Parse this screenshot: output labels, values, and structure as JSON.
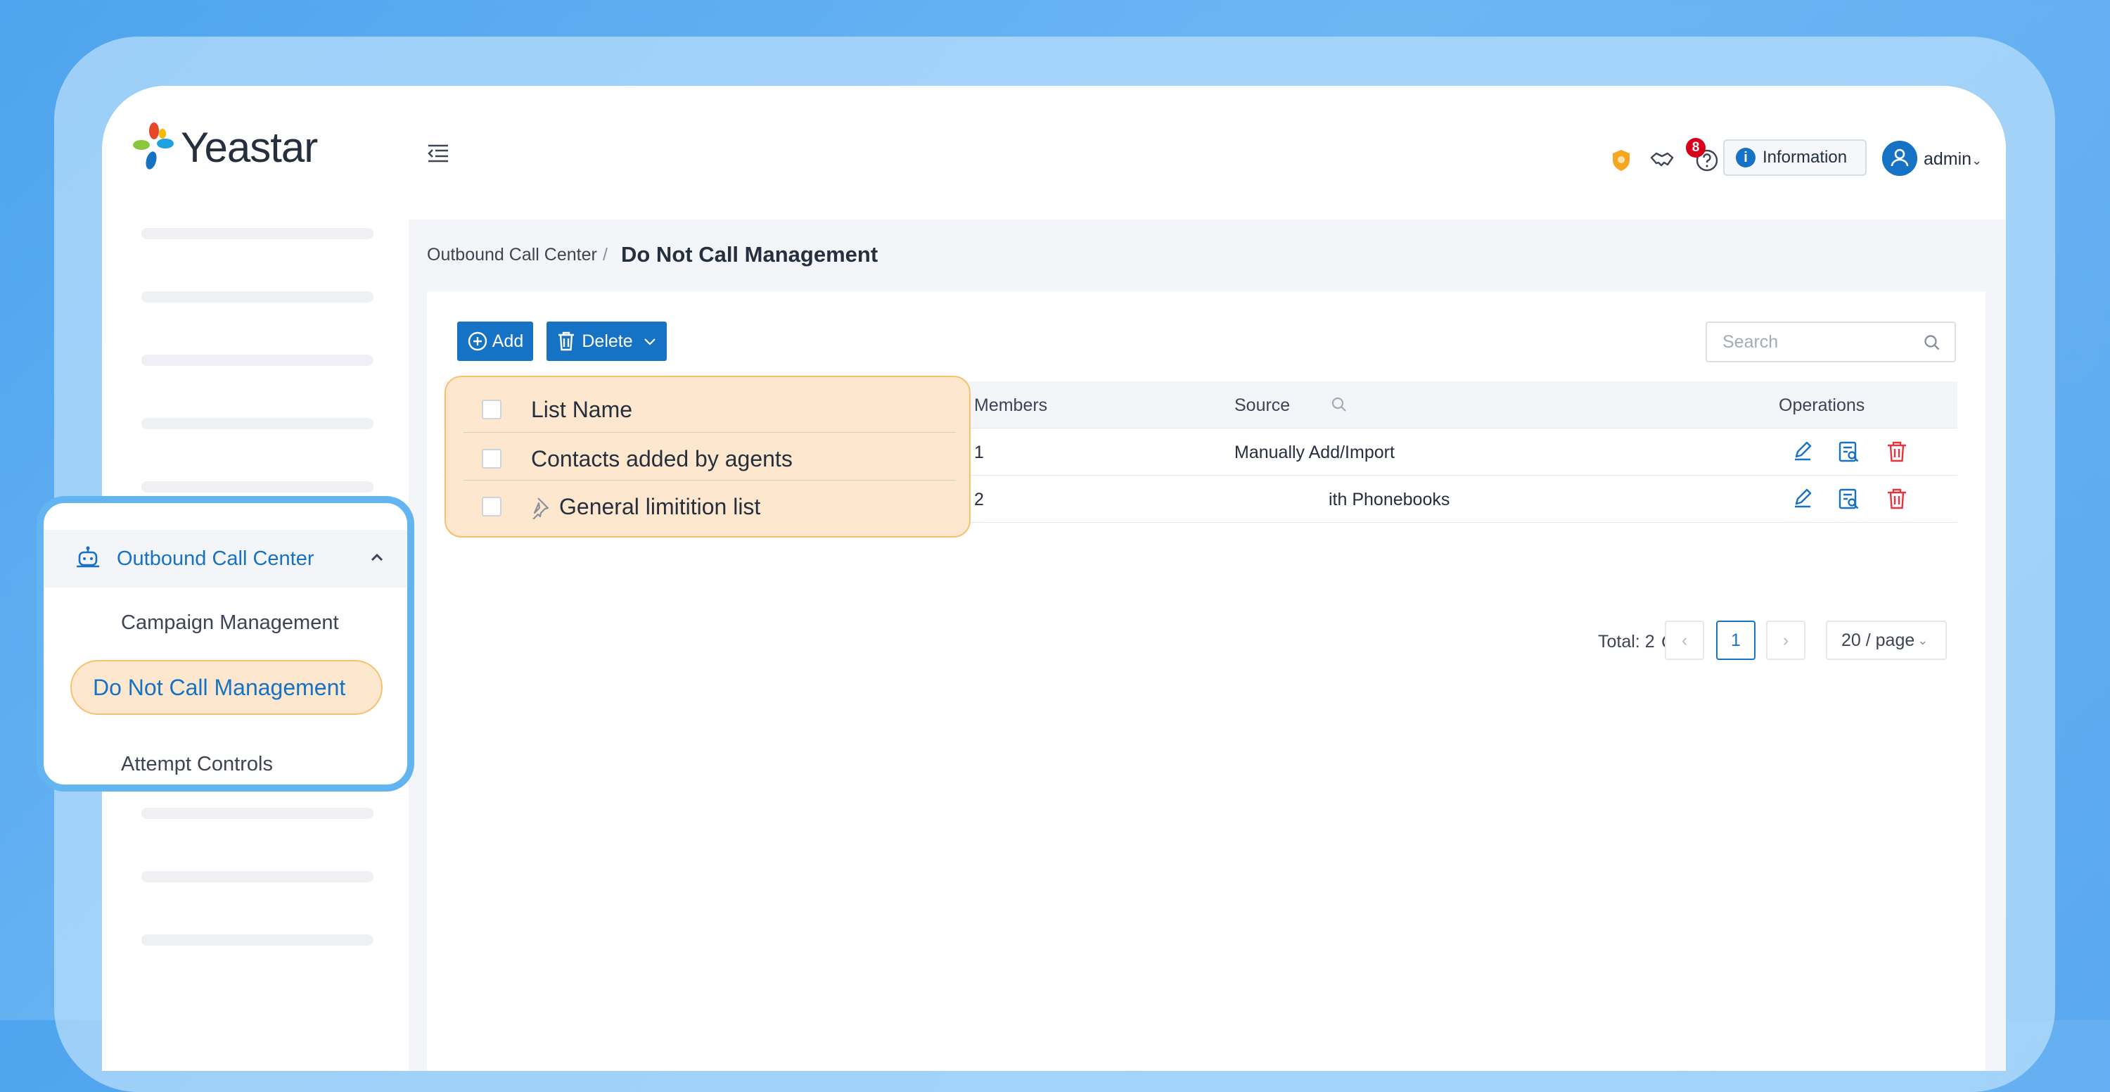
{
  "app": {
    "brand": "Yeastar"
  },
  "header": {
    "notification_count": "8",
    "information_label": "Information",
    "user_label": "admin"
  },
  "breadcrumb": {
    "parent": "Outbound Call Center",
    "separator": "/",
    "current": "Do Not Call Management"
  },
  "toolbar": {
    "add_label": "Add",
    "delete_label": "Delete",
    "search_placeholder": "Search"
  },
  "table": {
    "columns": [
      "List Name",
      "Members",
      "Source",
      "Operations"
    ],
    "rows": [
      {
        "name": "Contacts added by agents",
        "members": "1",
        "source": "Manually Add/Import",
        "pinned": false
      },
      {
        "name": "General limitition list",
        "members": "2",
        "source": "ith Phonebooks",
        "pinned": true
      }
    ]
  },
  "pagination": {
    "total_label": "Total: 2",
    "current_page": "1",
    "page_size": "20 / page"
  },
  "sidebar": {
    "group_label": "Outbound Call Center",
    "items": [
      "Campaign Management",
      "Do Not Call Management",
      "Attempt Controls"
    ],
    "active_item": "Do Not Call Management"
  },
  "colors": {
    "accent": "#1572c4",
    "highlight_fill": "#fde8cf",
    "highlight_border": "#f7c16e",
    "callout_border": "#63b5f2",
    "delete_red": "#e5333f"
  }
}
